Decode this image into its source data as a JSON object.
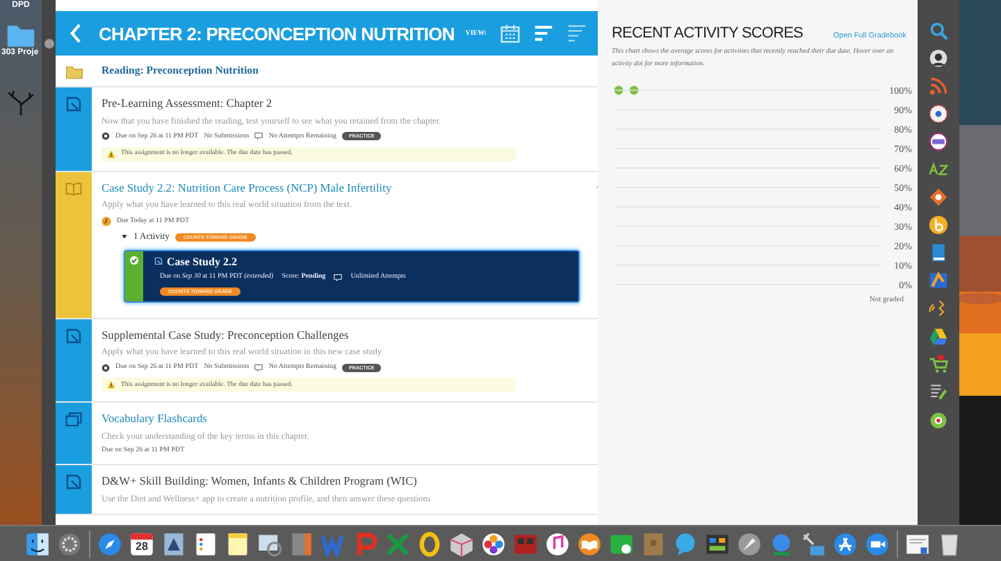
{
  "desktop": {
    "labels": [
      "DPD",
      "303 Proje"
    ]
  },
  "header": {
    "title": "CHAPTER 2: PRECONCEPTION NUTRITION",
    "view_label": "VIEW:"
  },
  "items": [
    {
      "kind": "reading",
      "title": "Reading: Preconception Nutrition"
    },
    {
      "kind": "assessment",
      "title": "Pre-Learning Assessment: Chapter 2",
      "description": "Now that you have finished the reading, test yourself to see what you retained from the chapter.",
      "due": "Due on Sep 26 at 11 PM PDT",
      "submissions": "No Submissions",
      "attempts": "No Attempts Remaining",
      "badge": "PRACTICE",
      "warning": "This assignment is no longer available. The due date has passed."
    },
    {
      "kind": "case",
      "title": "Case Study 2.2: Nutrition Care Process (NCP) Male Infertility",
      "description": "Apply what you have learned to this real world situation from the text.",
      "due": "Due Today at 11 PM PDT",
      "activities": {
        "label": "1 Activity",
        "expanded": true,
        "badge": "COUNTS TOWARD GRADE",
        "card": {
          "title": "Case Study 2.2",
          "completed": true,
          "due": "Due on *Sep 30* at 11 PM PDT *(extended)*",
          "score": "Score: **Pending**",
          "attempts": "Unlimited Attempts",
          "badge": "COUNTS TOWARD GRADE"
        }
      }
    },
    {
      "kind": "assessment",
      "title": "Supplemental Case Study: Preconception Challenges",
      "description": "Apply what you have learned to this real world situation in this new case study",
      "due": "Due on Sep 26 at 11 PM PDT",
      "submissions": "No Submissions",
      "attempts": "No Attempts Remaining",
      "badge": "PRACTICE",
      "warning": "This assignment is no longer available. The due date has passed."
    },
    {
      "kind": "flashcards",
      "title": "Vocabulary Flashcards",
      "description": "Check your understanding of the key terms in this chapter.",
      "due": "Due on Sep 26 at 11 PM PDT"
    },
    {
      "kind": "assessment",
      "title": "D&W+ Skill Building: Women, Infants & Children Program (WIC)",
      "description": "Use the Diet and Wellness+ app to create a nutrition profile, and then answer these questions"
    }
  ],
  "scores": {
    "title": "RECENT ACTIVITY SCORES",
    "link": "Open Full Gradebook",
    "description": "This chart shows the average scores for activities that recently reached their due date. Hover over an activity dot for more information.",
    "axis_labels": [
      "100%",
      "90%",
      "80%",
      "70%",
      "60%",
      "50%",
      "40%",
      "30%",
      "20%",
      "10%",
      "0%"
    ],
    "not_graded": "Not graded"
  },
  "calendar_day": "28"
}
